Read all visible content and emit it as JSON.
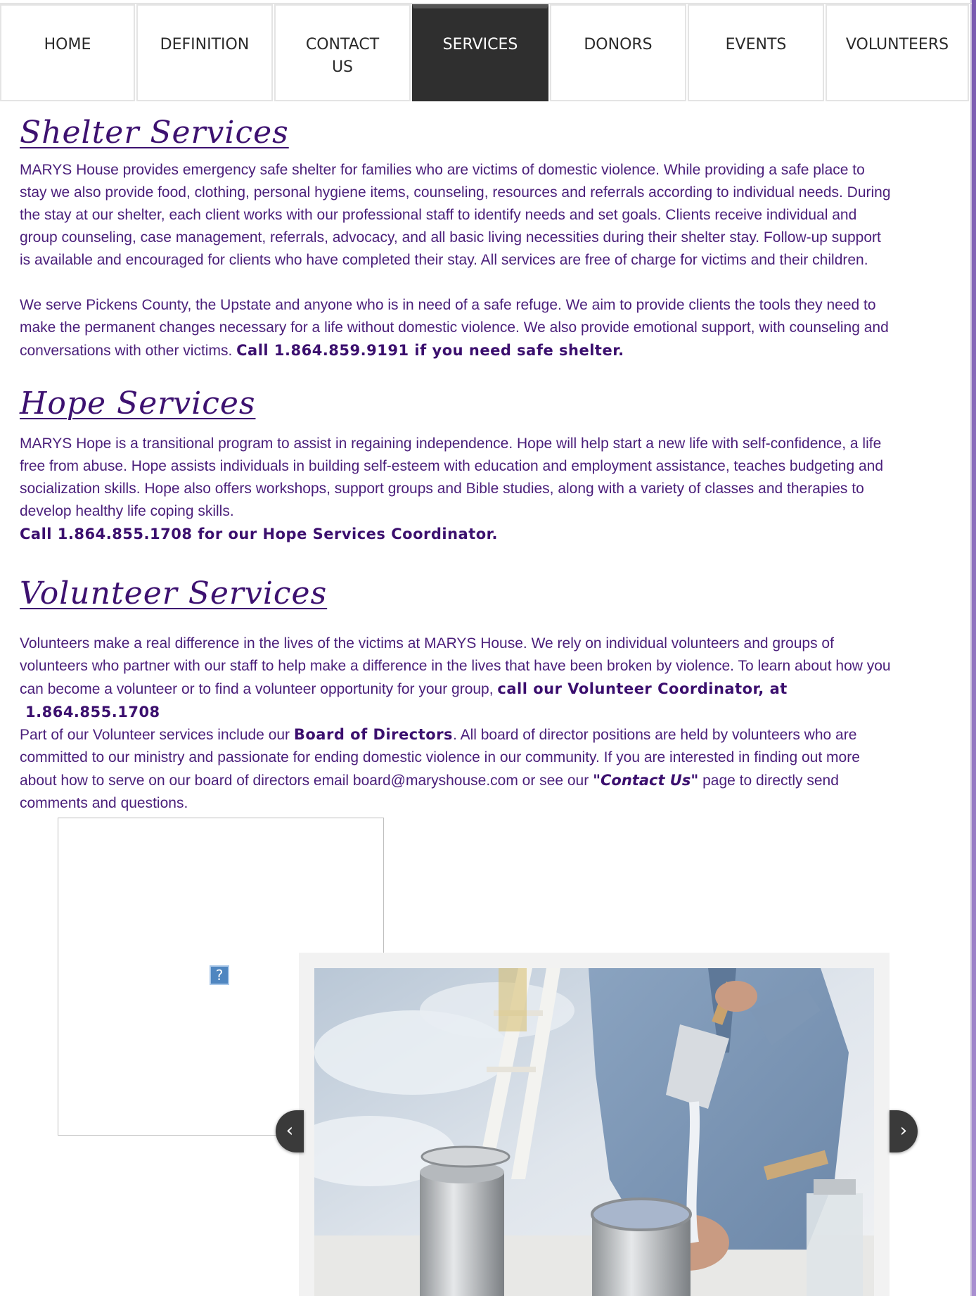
{
  "nav": {
    "items": [
      {
        "label": "HOME"
      },
      {
        "label": "DEFINITION"
      },
      {
        "label_line1": "CONTACT",
        "label_line2": "US"
      },
      {
        "label": "SERVICES"
      },
      {
        "label": "DONORS"
      },
      {
        "label": "EVENTS"
      },
      {
        "label": "VOLUNTEERS"
      }
    ],
    "active": "SERVICES"
  },
  "shelter": {
    "heading": "Shelter Services",
    "p1": "MARYS House provides emergency safe shelter for families who are victims of domestic violence. While providing a safe place to stay we also provide food, clothing, personal hygiene items, counseling, resources and referrals according to individual needs. During the stay at our shelter, each client works with our professional staff to identify needs and set goals. Clients receive individual and group counseling, case management, referrals, advocacy, and all basic living necessities during their shelter stay. Follow-up support is available  and encouraged for clients who have completed their stay. All services are free of charge for victims and their children.",
    "p2": "We serve Pickens County, the Upstate and anyone who is in need of a safe refuge. We aim to provide  clients the tools they need to make the permanent changes necessary for a life without domestic violence.  We also provide emotional support, with counseling and conversations with other victims. ",
    "p2_bold": "Call 1.864.859.9191 if you need safe shelter."
  },
  "hope": {
    "heading": "Hope Services",
    "p1": "MARYS Hope is a transitional program to assist in regaining independence. Hope will help start a new life with self-confidence, a life free from abuse. Hope assists individuals in building self-esteem with education and employment assistance, teaches budgeting and socialization skills. Hope also offers workshops, support groups and Bible studies, along with a variety of classes and therapies to develop healthy life coping skills.",
    "call": "Call 1.864.855.1708 for our Hope Services Coordinator."
  },
  "volunteer": {
    "heading": "Volunteer Services",
    "p1": "Volunteers make a real difference in the lives of the victims at MARYS House. We rely on individual volunteers and groups of volunteers who partner with our staff to help make a difference in the lives that have been broken by violence. To learn about how you can become a volunteer or to find a volunteer opportunity for your group, ",
    "p1_bold": "call our Volunteer Coordinator, at",
    "phone": "1.864.855.1708",
    "p2_start": "Part of our Volunteer services include our ",
    "p2_bold": "Board of Directors",
    "p2_mid": ". All board of director positions are held by volunteers who are committed to our ministry and passionate for ending domestic violence in our community.  If you are interested in finding out more about how to serve on our board of directors email board@maryshouse.com or see our ",
    "p2_link": "\"Contact Us\"",
    "p2_end": " page to directly send comments and questions."
  },
  "widget": {
    "icon": "?"
  },
  "slideshow": {
    "prev_icon": "chevron-left-icon",
    "next_icon": "chevron-right-icon",
    "prev_glyph": "‹",
    "next_glyph": "›"
  }
}
